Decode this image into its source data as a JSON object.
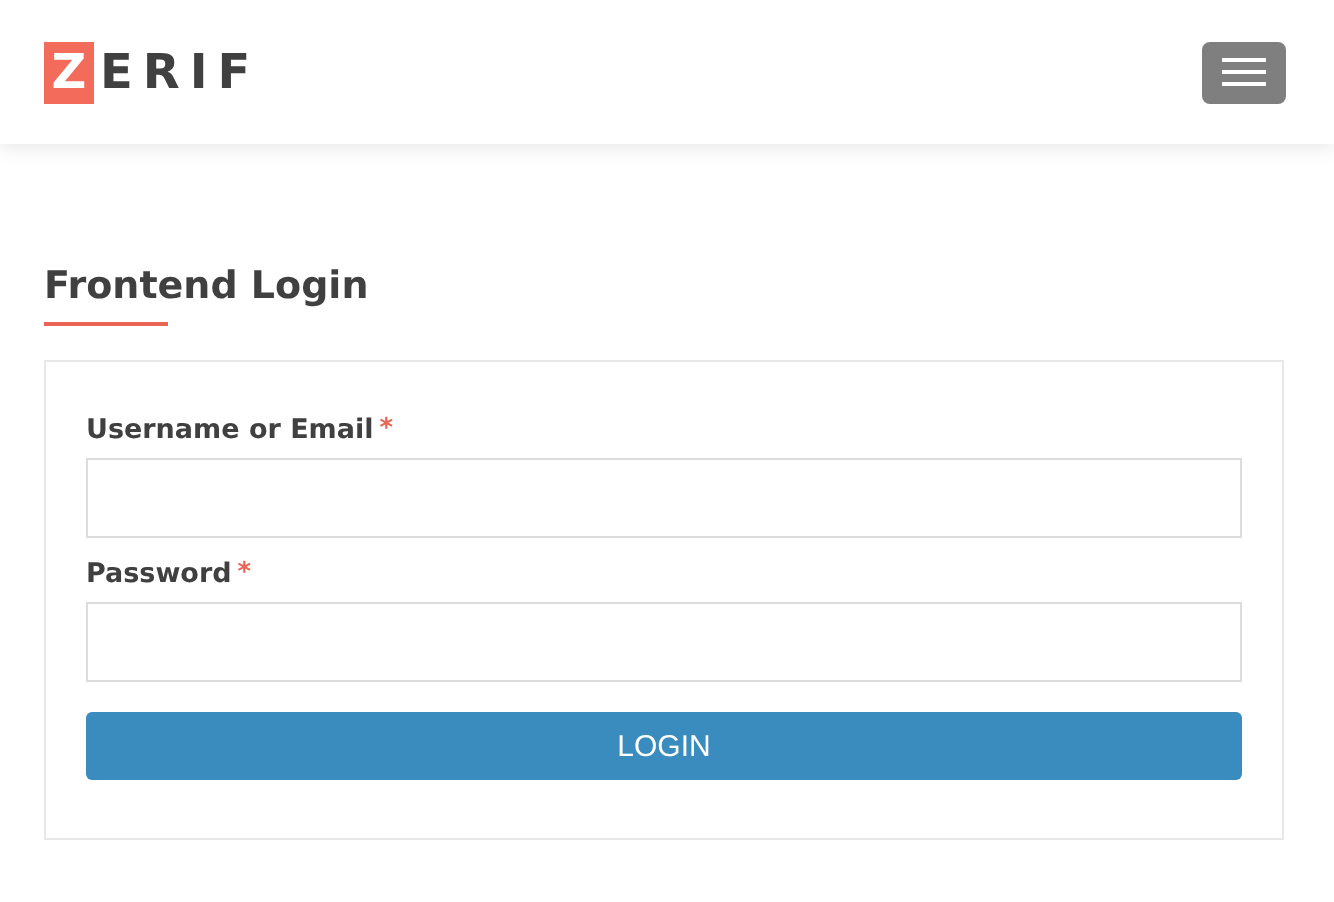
{
  "header": {
    "logo": {
      "badge_letter": "Z",
      "rest": "ERIF"
    },
    "menu_button": {
      "kind": "hamburger"
    }
  },
  "login": {
    "title": "Frontend Login",
    "fields": [
      {
        "label": "Username or Email",
        "required_mark": "*"
      },
      {
        "label": "Password",
        "required_mark": "*"
      }
    ],
    "submit": "LOGIN"
  }
}
